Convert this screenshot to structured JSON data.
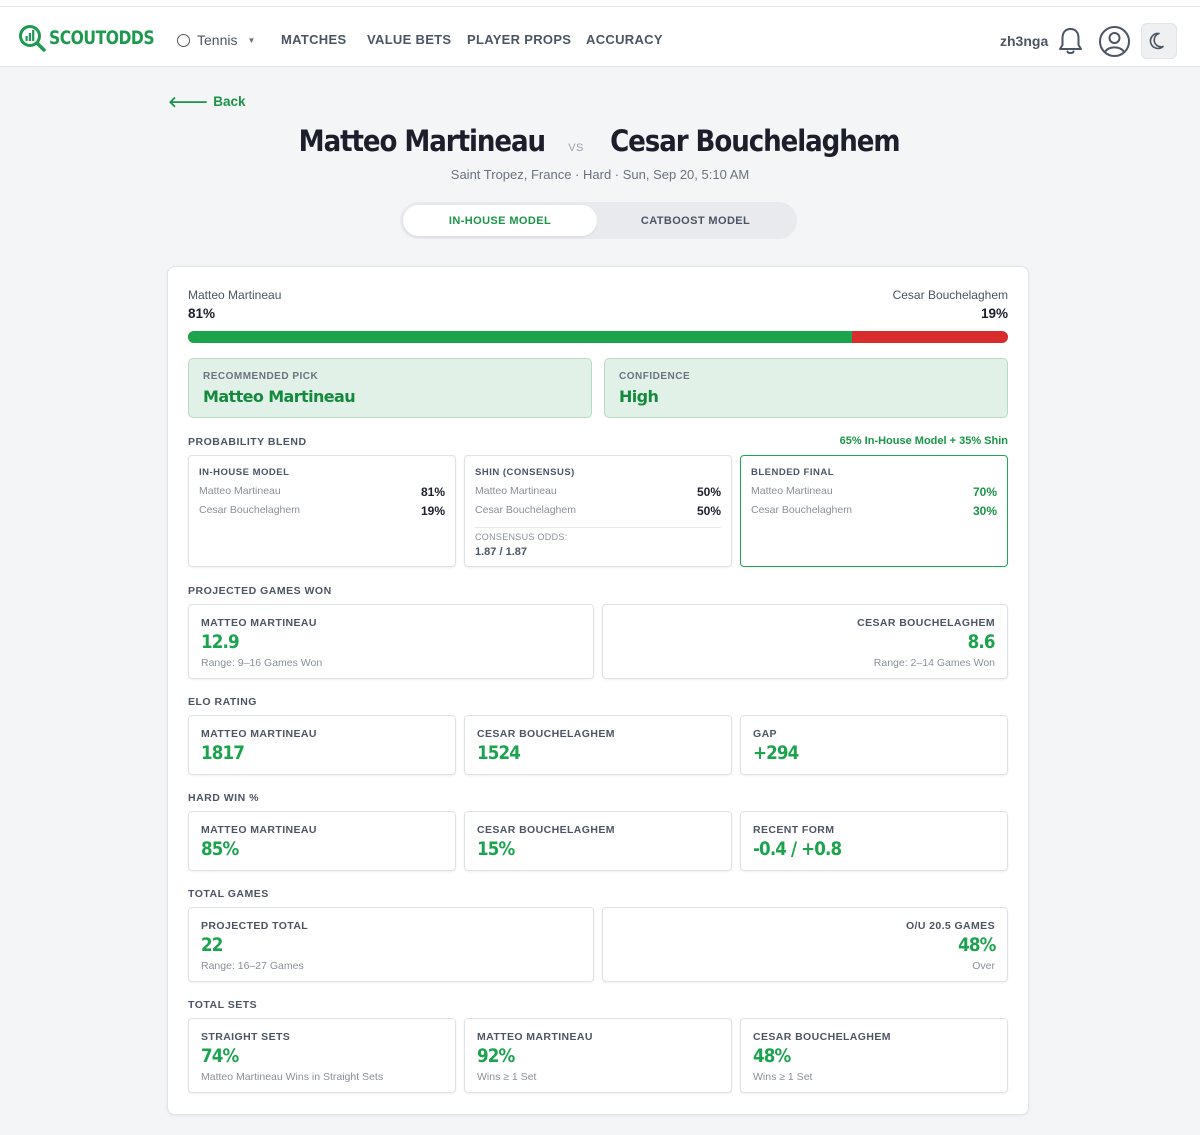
{
  "nav": {
    "logo_text": "SCOUTODDS",
    "sport": "Tennis",
    "items": [
      "MATCHES",
      "VALUE BETS",
      "PLAYER PROPS",
      "ACCURACY"
    ],
    "username": "zh3nga"
  },
  "back_label": "Back",
  "match": {
    "player1": "Matteo Martineau",
    "vs": "VS",
    "player2": "Cesar Bouchelaghem",
    "subtitle": "Saint Tropez, France · Hard · Sun, Sep 20, 5:10 AM"
  },
  "model_tabs": {
    "active": "IN-HOUSE MODEL",
    "inactive": "CATBOOST MODEL"
  },
  "win_prob": {
    "p1_name": "Matteo Martineau",
    "p1_pct": "81%",
    "p1_fraction": 0.81,
    "p2_name": "Cesar Bouchelaghem",
    "p2_pct": "19%",
    "colors": {
      "p1": "#1ca34e",
      "p2": "#d92d2d"
    }
  },
  "recommended": {
    "label": "RECOMMENDED PICK",
    "value": "Matteo Martineau"
  },
  "confidence": {
    "label": "CONFIDENCE",
    "value": "High"
  },
  "blend": {
    "label": "PROBABILITY BLEND",
    "note": "65% In-House Model + 35% Shin",
    "cards": [
      {
        "title": "IN-HOUSE MODEL",
        "rows": [
          {
            "name": "Matteo Martineau",
            "pct": "81%"
          },
          {
            "name": "Cesar Bouchelaghem",
            "pct": "19%"
          }
        ]
      },
      {
        "title": "SHIN (CONSENSUS)",
        "rows": [
          {
            "name": "Matteo Martineau",
            "pct": "50%"
          },
          {
            "name": "Cesar Bouchelaghem",
            "pct": "50%"
          }
        ],
        "odds_label": "CONSENSUS ODDS:",
        "odds": "1.87 / 1.87"
      },
      {
        "title": "BLENDED FINAL",
        "rows": [
          {
            "name": "Matteo Martineau",
            "pct": "70%"
          },
          {
            "name": "Cesar Bouchelaghem",
            "pct": "30%"
          }
        ]
      }
    ]
  },
  "games_won": {
    "label": "PROJECTED GAMES WON",
    "p1": {
      "title": "MATTEO MARTINEAU",
      "value": "12.9",
      "range": "Range: 9–16 Games Won"
    },
    "p2": {
      "title": "CESAR BOUCHELAGHEM",
      "value": "8.6",
      "range": "Range: 2–14 Games Won"
    }
  },
  "elo": {
    "label": "ELO RATING",
    "cards": [
      {
        "title": "MATTEO MARTINEAU",
        "value": "1817"
      },
      {
        "title": "CESAR BOUCHELAGHEM",
        "value": "1524"
      },
      {
        "title": "GAP",
        "value": "+294"
      }
    ]
  },
  "hard_win": {
    "label": "HARD WIN %",
    "cards": [
      {
        "title": "MATTEO MARTINEAU",
        "value": "85%"
      },
      {
        "title": "CESAR BOUCHELAGHEM",
        "value": "15%"
      },
      {
        "title": "RECENT FORM",
        "value": "-0.4 / +0.8"
      }
    ]
  },
  "total_games": {
    "label": "TOTAL GAMES",
    "projected": {
      "title": "PROJECTED TOTAL",
      "value": "22",
      "range": "Range: 16–27 Games"
    },
    "ou": {
      "title": "O/U 20.5 GAMES",
      "value": "48%",
      "sub": "Over"
    }
  },
  "total_sets": {
    "label": "TOTAL SETS",
    "cards": [
      {
        "title": "STRAIGHT SETS",
        "value": "74%",
        "sub": "Matteo Martineau Wins in Straight Sets"
      },
      {
        "title": "MATTEO MARTINEAU",
        "value": "92%",
        "sub": "Wins ≥ 1 Set"
      },
      {
        "title": "CESAR BOUCHELAGHEM",
        "value": "48%",
        "sub": "Wins ≥ 1 Set"
      }
    ]
  },
  "icons": [
    "scoutodds-logo-icon",
    "tennis-ball-icon",
    "chevron-down-icon",
    "bell-icon",
    "user-icon",
    "moon-icon",
    "arrow-left-icon"
  ]
}
